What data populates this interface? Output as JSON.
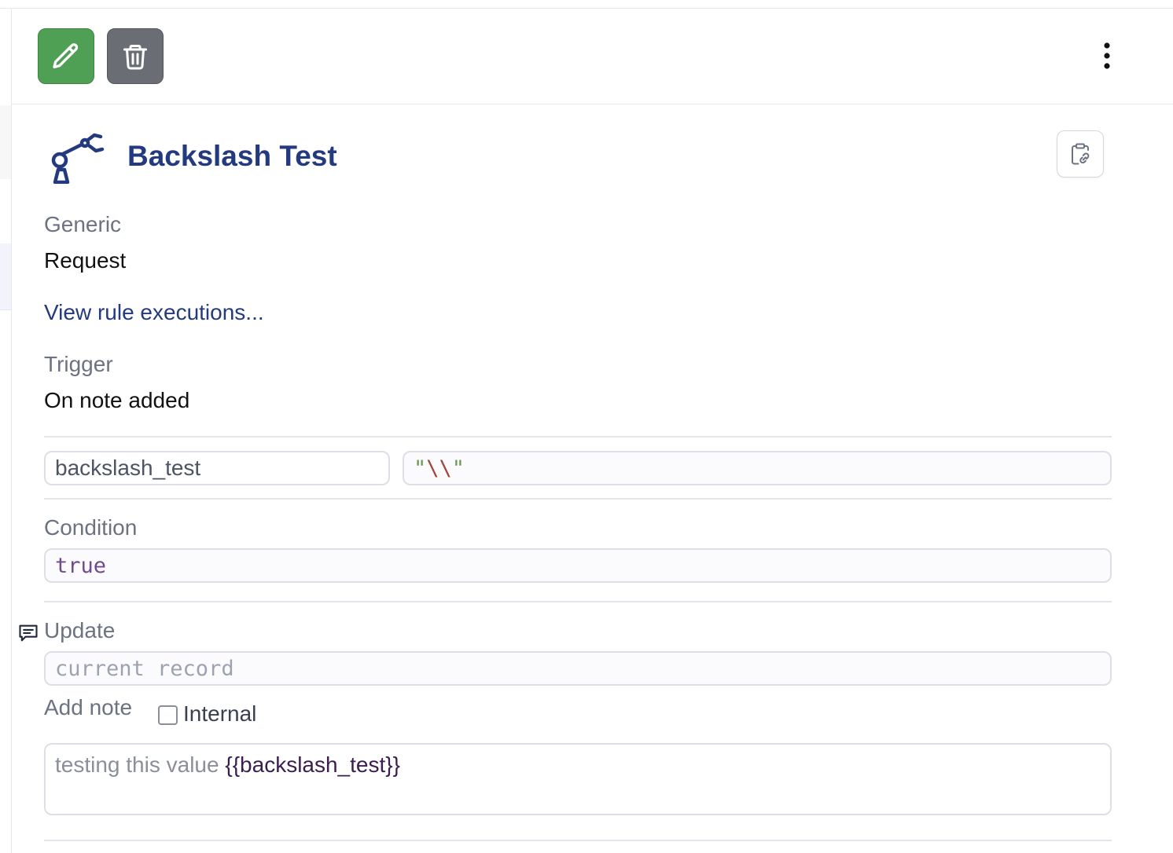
{
  "toolbar": {
    "edit_icon": "pencil-icon",
    "delete_icon": "trash-icon",
    "more_icon": "kebab-vertical-icon"
  },
  "rule": {
    "icon": "robot-arm-icon",
    "title": "Backslash Test",
    "copy_icon": "clipboard-link-icon",
    "type_label": "Generic",
    "type_value": "Request",
    "executions_link": "View rule executions...",
    "trigger_label": "Trigger",
    "trigger_value": "On note added"
  },
  "variable": {
    "name": "backslash_test",
    "value_quote_open": "\"",
    "value_backslashes": "\\\\",
    "value_quote_close": "\""
  },
  "condition": {
    "label": "Condition",
    "value": "true"
  },
  "update": {
    "icon": "chat-note-icon",
    "label": "Update",
    "target_placeholder": "current record"
  },
  "add_note": {
    "label": "Add note",
    "internal_label": "Internal",
    "internal_checked": false,
    "text_prefix": "testing this value ",
    "text_variable": "{{backslash_test}}"
  },
  "colors": {
    "edit_button": "#4f9f55",
    "delete_button": "#6b6d75",
    "title": "#243a7f",
    "link": "#243a7f",
    "string_quote": "#6a9955",
    "escape_chars": "#a0463c",
    "keyword": "#6f4a8e",
    "template_var": "#3b1d4f"
  }
}
